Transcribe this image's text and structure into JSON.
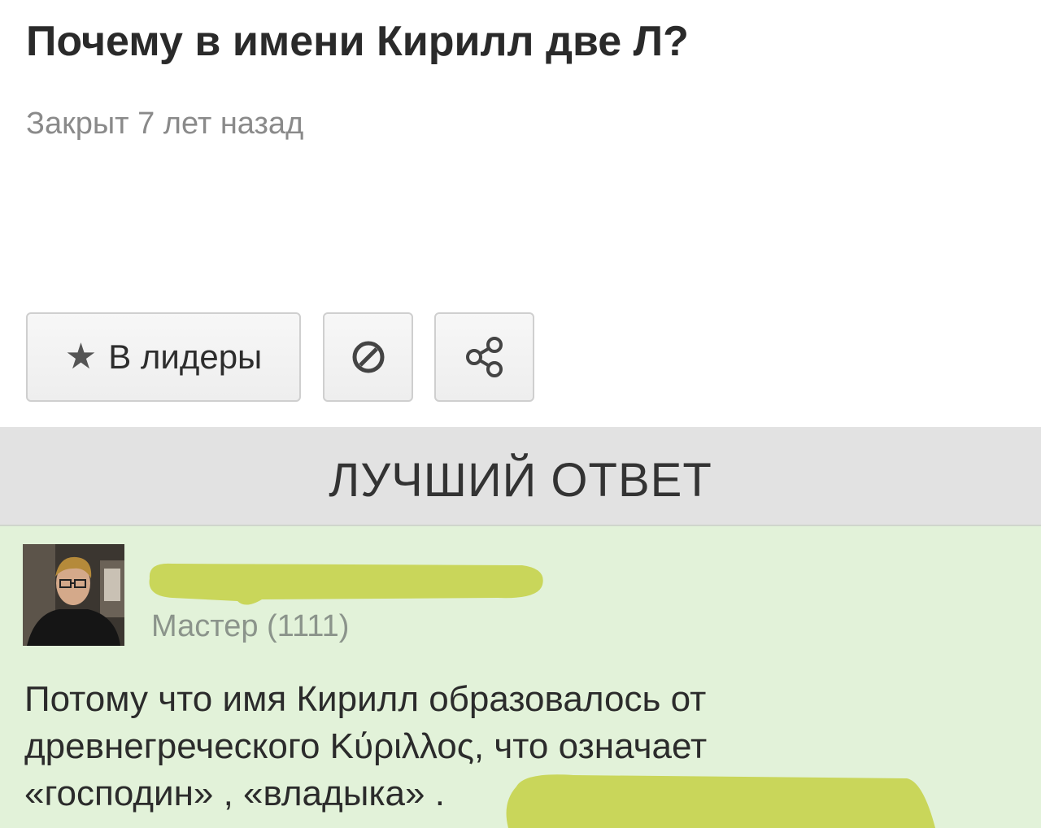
{
  "question": {
    "title": "Почему в имени Кирилл две Л?",
    "status": "Закрыт 7 лет назад"
  },
  "actions": {
    "leaders_icon": "★",
    "leaders_label": "В лидеры",
    "report_icon": "block-icon",
    "share_icon": "share-icon"
  },
  "best_answer": {
    "header": "ЛУЧШИЙ ОТВЕТ",
    "author": {
      "rank": "Мастер (1111)"
    },
    "text_lines": [
      "Потому что имя Кирилл образовалось от",
      "древнегреческого Κύριλλος, что означает",
      "«господин» , «владыка» ."
    ]
  },
  "colors": {
    "answer_bg": "#e2f2d9",
    "header_bg": "#e2e2e2",
    "redaction": "#c9d65a"
  }
}
